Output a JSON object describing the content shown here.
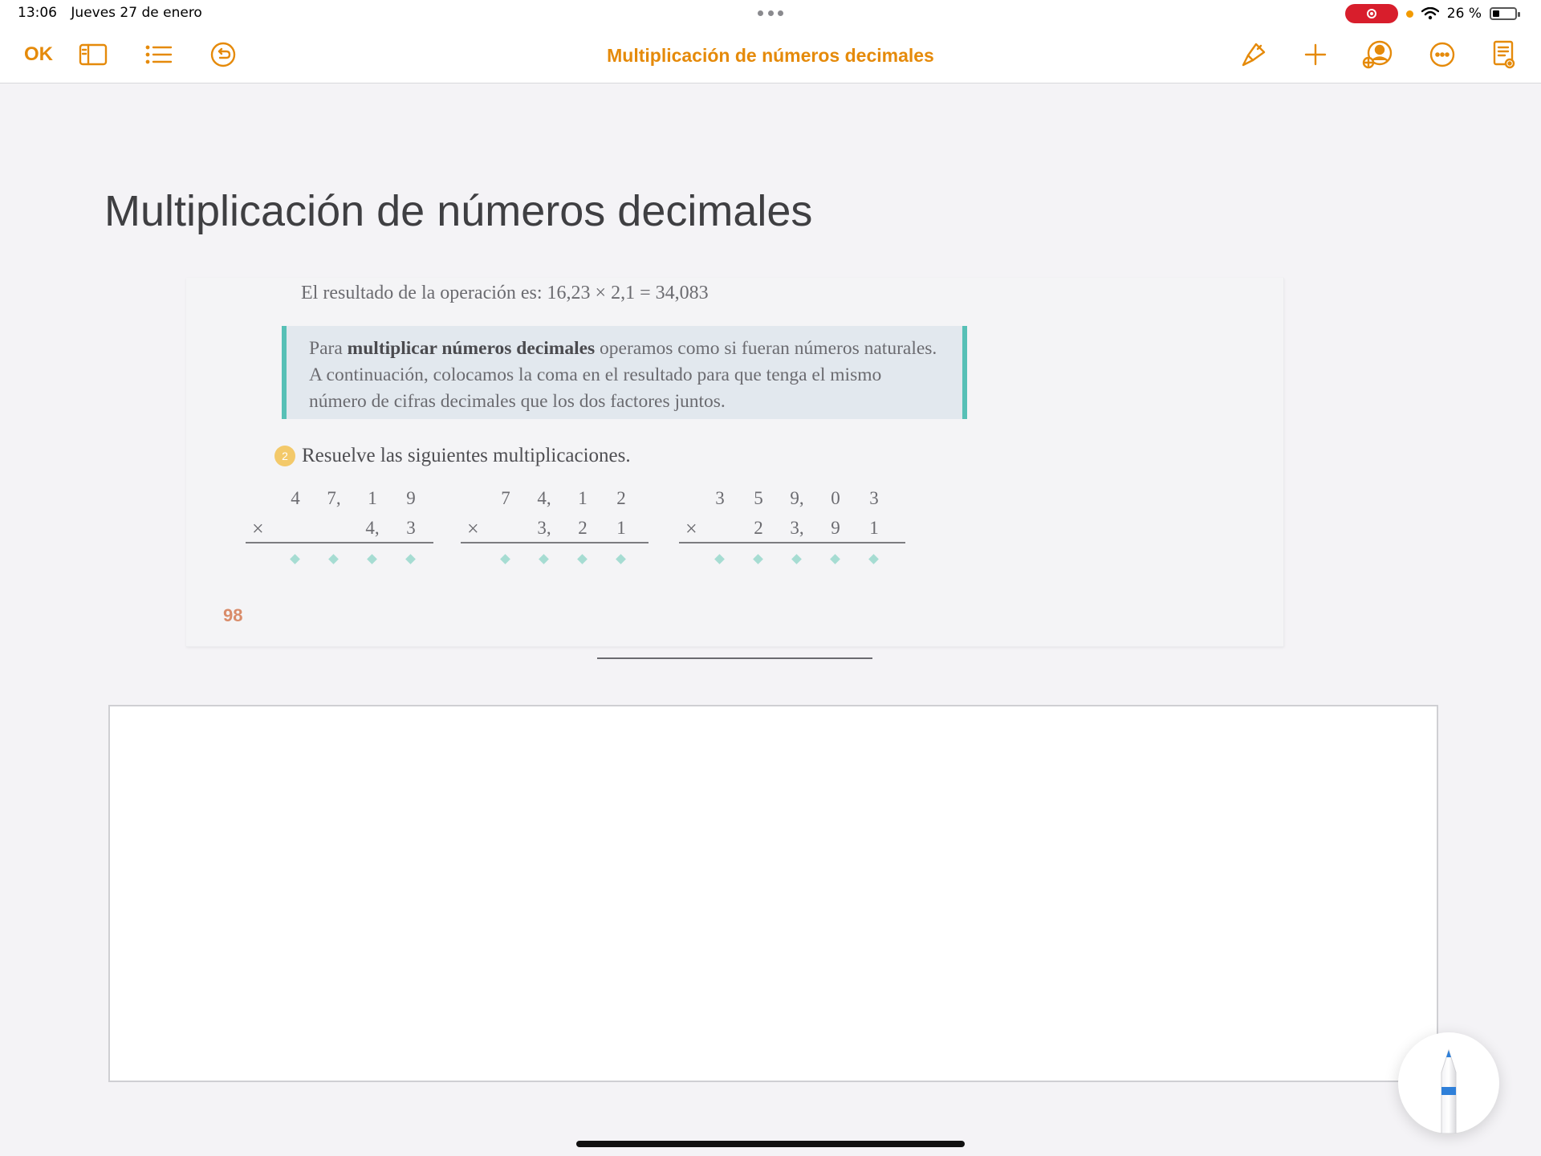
{
  "status_bar": {
    "time": "13:06",
    "date": "Jueves 27 de enero",
    "battery": "26 %"
  },
  "toolbar": {
    "ok_label": "OK",
    "title": "Multiplicación de números decimales",
    "accent_color": "#e58a0a",
    "left_icons": [
      "sidebar-icon",
      "list-icon",
      "undo-icon"
    ],
    "right_icons": [
      "paintbrush-icon",
      "plus-icon",
      "collaborate-icon",
      "more-icon",
      "document-icon"
    ]
  },
  "document": {
    "heading": "Multiplicación de números decimales",
    "page": {
      "result_line": "El resultado de la operación es: 16,23 × 2,1 = 34,083",
      "info": {
        "pre": "Para ",
        "bold": "multiplicar números decimales",
        "post": " operamos como si fueran números na­turales. A continuación, colocamos la coma en el resultado para que tenga el mismo número de cifras decimales que los dos factores juntos."
      },
      "exercise_number": "2",
      "exercise_text": "Resuelve las siguientes multiplicaciones.",
      "multiplications": [
        {
          "top": [
            "4",
            "7,",
            "1",
            "9"
          ],
          "bottom": [
            "",
            "",
            "4,",
            "3"
          ]
        },
        {
          "top": [
            "7",
            "4,",
            "1",
            "2"
          ],
          "bottom": [
            "",
            "3,",
            "2",
            "1"
          ]
        },
        {
          "top": [
            "3",
            "5",
            "9,",
            "0",
            "3"
          ],
          "bottom": [
            "",
            "2",
            "3,",
            "9",
            "1"
          ]
        }
      ],
      "times_symbol": "×",
      "page_number": "98"
    }
  }
}
